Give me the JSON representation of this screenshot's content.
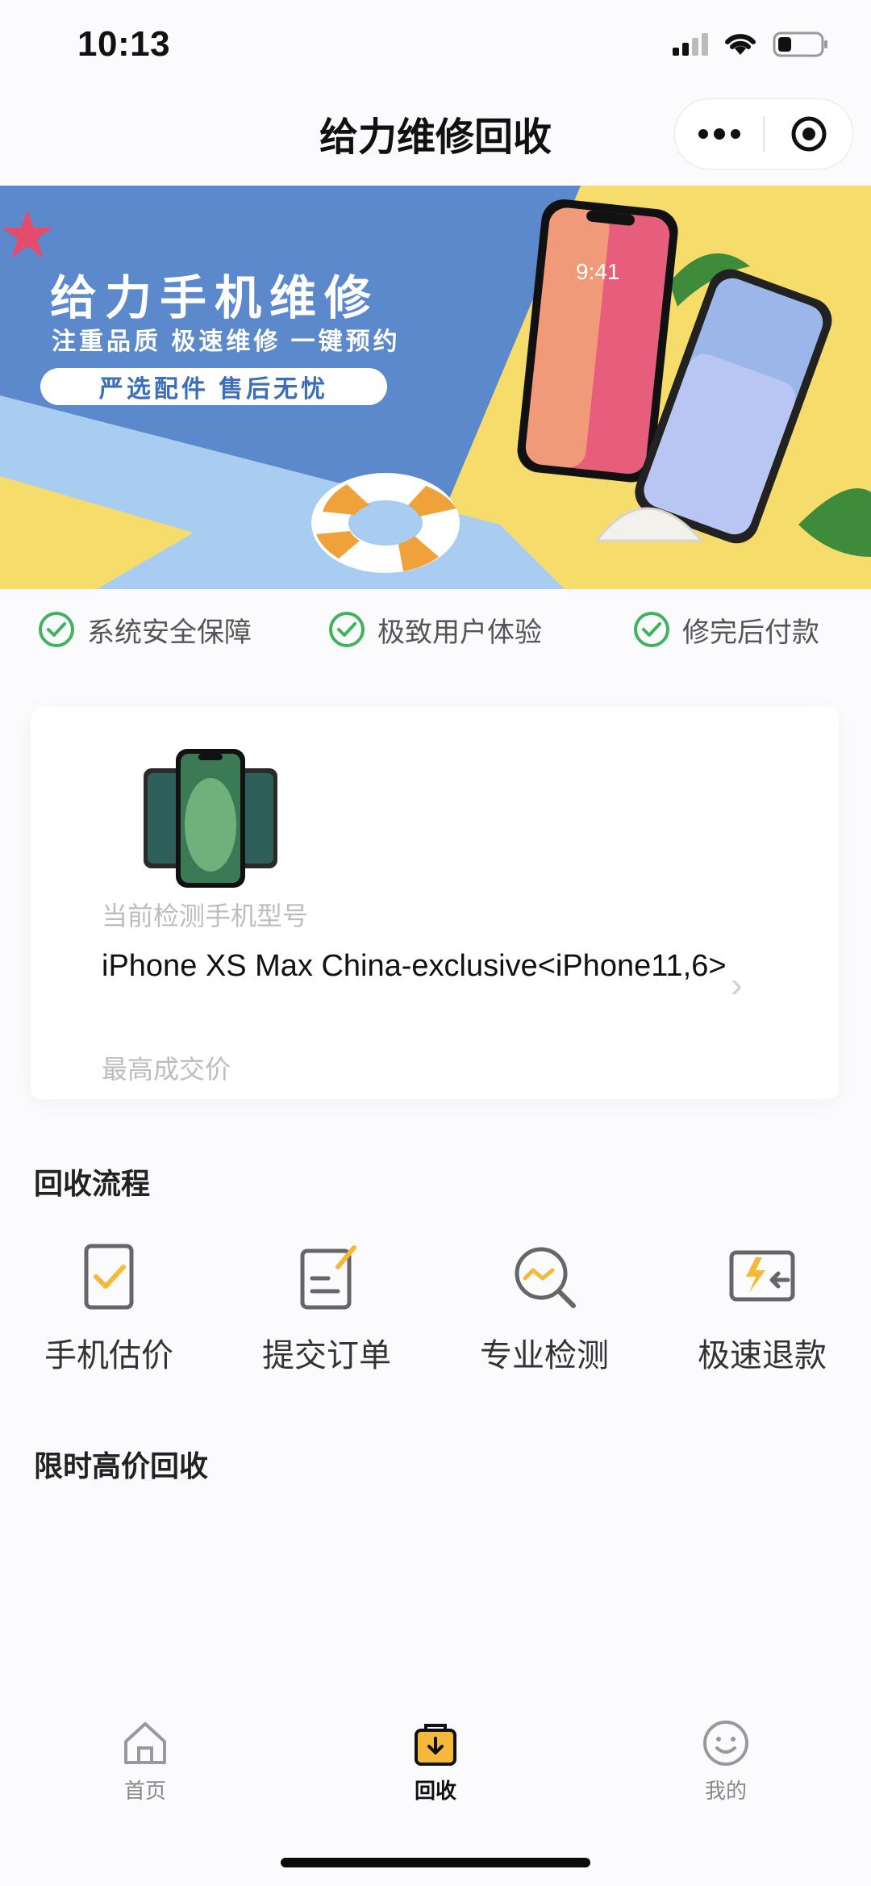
{
  "status": {
    "time": "10:13"
  },
  "nav": {
    "title": "给力维修回收",
    "more_icon": "more-dots-icon",
    "close_icon": "target-circle-icon"
  },
  "banner": {
    "title": "给力手机维修",
    "subtitle": "注重品质 极速维修 一键预约",
    "pill": "严选配件 售后无忧",
    "phone_time": "9:41"
  },
  "features": [
    {
      "label": "系统安全保障"
    },
    {
      "label": "极致用户体验"
    },
    {
      "label": "修完后付款"
    }
  ],
  "device_card": {
    "label": "当前检测手机型号",
    "model": "iPhone XS Max China-exclusive<iPhone11,6>",
    "price_label": "最高成交价"
  },
  "process_section": {
    "title": "回收流程",
    "steps": [
      {
        "label": "手机估价",
        "icon": "phone-check-icon"
      },
      {
        "label": "提交订单",
        "icon": "edit-form-icon"
      },
      {
        "label": "专业检测",
        "icon": "inspect-magnifier-icon"
      },
      {
        "label": "极速退款",
        "icon": "fast-refund-icon"
      }
    ]
  },
  "limited_section": {
    "title": "限时高价回收"
  },
  "tabbar": {
    "tabs": [
      {
        "label": "首页",
        "icon": "home-icon",
        "active": false
      },
      {
        "label": "回收",
        "icon": "recycle-bag-icon",
        "active": true
      },
      {
        "label": "我的",
        "icon": "smiley-icon",
        "active": false
      }
    ]
  },
  "colors": {
    "accent": "#f4b93a",
    "check_green": "#41b35d",
    "banner_blue": "#5b89cc",
    "banner_yellow": "#f6dc6a"
  }
}
